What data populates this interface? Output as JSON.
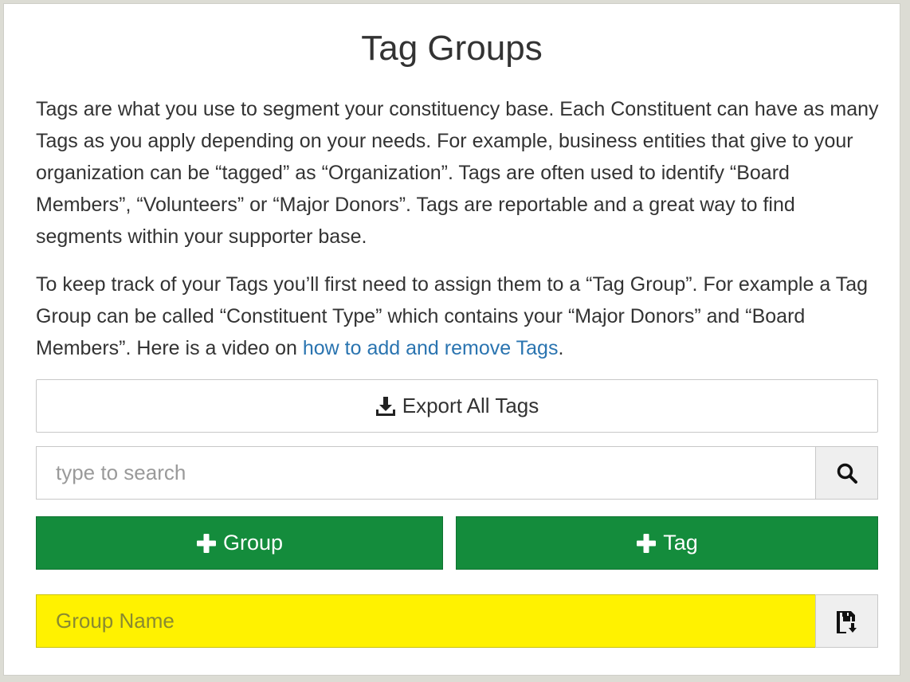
{
  "page": {
    "title": "Tag Groups"
  },
  "intro": {
    "paragraph1": "Tags are what you use to segment your constituency base. Each Constituent can have as many Tags as you apply depending on your needs. For example, business entities that give to your organization can be “tagged” as “Organization”. Tags are often used to identify “Board Members”, “Volunteers” or “Major Donors”. Tags are reportable and a great way to find segments within your supporter base.",
    "paragraph2_before_link": "To keep track of your Tags you’ll first need to assign them to a “Tag Group”. For example a Tag Group can be called “Constituent Type” which contains your “Major Donors” and “Board Members”. Here is a video on ",
    "paragraph2_link": "how to add and remove Tags",
    "paragraph2_after_link": "."
  },
  "toolbar": {
    "export_label": "Export All Tags",
    "export_icon": "download-icon",
    "search_placeholder": "type to search",
    "search_value": "",
    "search_icon": "search-icon",
    "add_group_label": "Group",
    "add_tag_label": "Tag",
    "add_icon": "plus-icon"
  },
  "group_form": {
    "placeholder": "Group Name",
    "value": "",
    "save_icon": "save-icon"
  },
  "colors": {
    "accent_green": "#148c3c",
    "highlight_yellow": "#fff200",
    "link_blue": "#2a74b0"
  }
}
